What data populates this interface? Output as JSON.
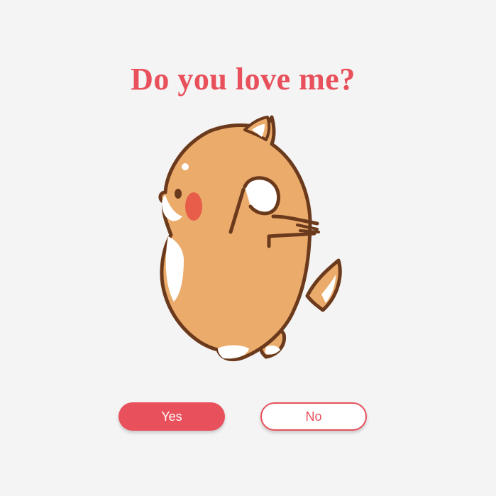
{
  "question": "Do you love me?",
  "buttons": {
    "yes_label": "Yes",
    "no_label": "No"
  },
  "mascot": {
    "description_icon": "shiba-dog-dancing-icon"
  },
  "colors": {
    "accent": "#e8505b",
    "background": "#f4f4f4",
    "fur": "#ebab6b",
    "outline": "#6b3a1c",
    "cheek": "#e85d4a"
  }
}
